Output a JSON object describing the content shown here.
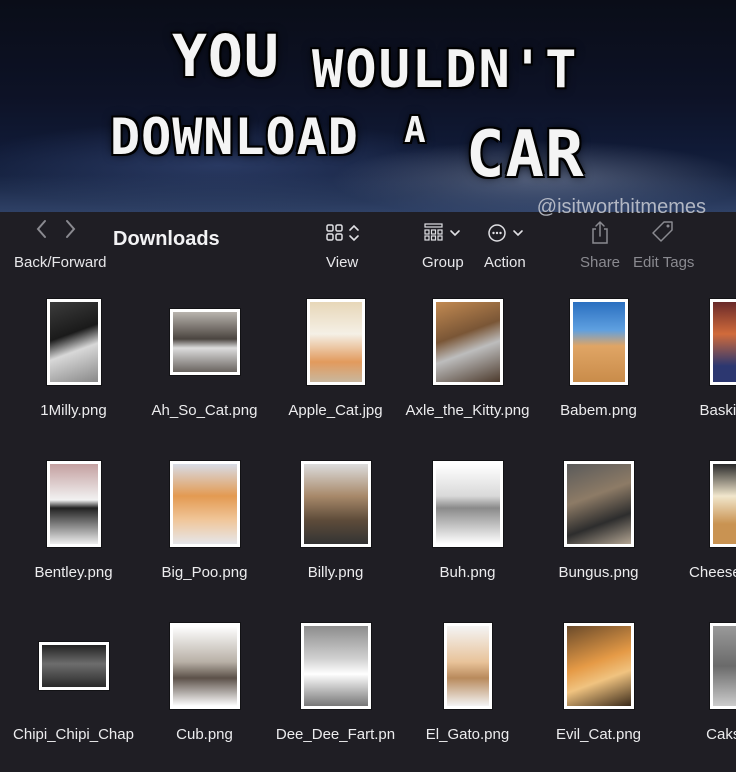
{
  "banner": {
    "line1": "YOU",
    "line2": "WOULDN'T",
    "line3": "DOWNLOAD",
    "line4": "A",
    "line5": "CAR",
    "watermark": "@isitworthitmemes"
  },
  "toolbar": {
    "back_forward_label": "Back/Forward",
    "title": "Downloads",
    "view_label": "View",
    "group_label": "Group",
    "action_label": "Action",
    "share_label": "Share",
    "edit_tags_label": "Edit Tags"
  },
  "colors": {
    "background": "#1f1e24",
    "text": "#ececee",
    "disabled_text": "#8a8a90"
  },
  "files": [
    {
      "name": "1Milly.png"
    },
    {
      "name": "Ah_So_Cat.png"
    },
    {
      "name": "Apple_Cat.jpg"
    },
    {
      "name": "Axle_the_Kitty.png"
    },
    {
      "name": "Babem.png"
    },
    {
      "name": "Baskit_C"
    },
    {
      "name": "Bentley.png"
    },
    {
      "name": "Big_Poo.png"
    },
    {
      "name": "Billy.png"
    },
    {
      "name": "Buh.png"
    },
    {
      "name": "Bungus.png"
    },
    {
      "name": "Cheesebu g"
    },
    {
      "name": "Chipi_Chipi_Chap"
    },
    {
      "name": "Cub.png"
    },
    {
      "name": "Dee_Dee_Fart.pn"
    },
    {
      "name": "El_Gato.png"
    },
    {
      "name": "Evil_Cat.png"
    },
    {
      "name": "Cakste"
    }
  ]
}
